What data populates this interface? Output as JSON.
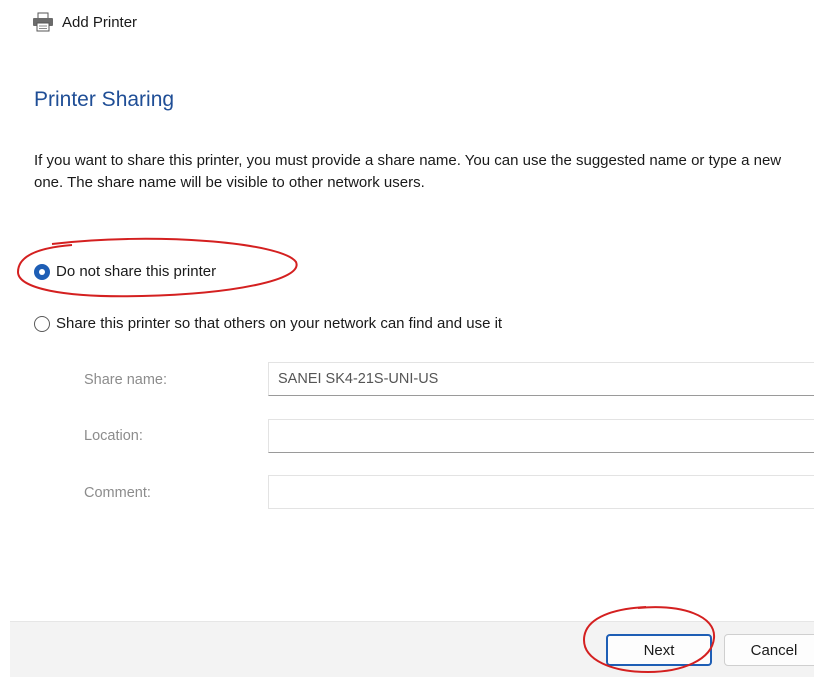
{
  "window": {
    "title": "Add Printer",
    "icon": "printer-icon"
  },
  "page": {
    "heading": "Printer Sharing",
    "description": "If you want to share this printer, you must provide a share name. You can use the suggested name or type a new one. The share name will be visible to other network users."
  },
  "sharing": {
    "options": [
      {
        "label": "Do not share this printer",
        "selected": true
      },
      {
        "label": "Share this printer so that others on your network can find and use it",
        "selected": false
      }
    ]
  },
  "fields": {
    "share_name": {
      "label": "Share name:",
      "value": "SANEI SK4-21S-UNI-US"
    },
    "location": {
      "label": "Location:",
      "value": ""
    },
    "comment": {
      "label": "Comment:",
      "value": ""
    }
  },
  "buttons": {
    "next": "Next",
    "cancel": "Cancel"
  },
  "colors": {
    "heading": "#1f4e96",
    "accent": "#1e5eb5",
    "annotation": "#d42020",
    "footer_bg": "#f3f3f3"
  }
}
